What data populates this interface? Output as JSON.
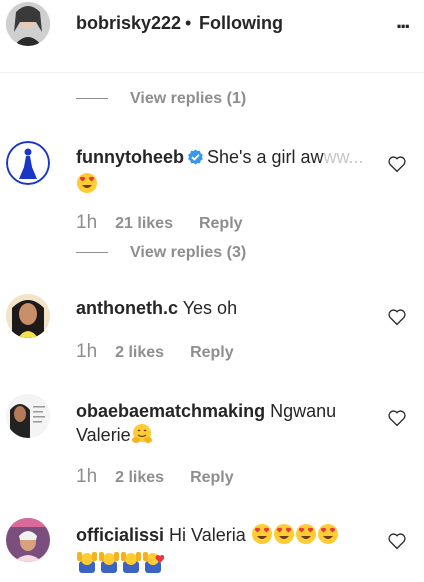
{
  "header": {
    "username": "bobrisky222",
    "separator": "•",
    "follow_status": "Following",
    "more_label": "..."
  },
  "prev_comment": {
    "view_replies": "View replies (1)"
  },
  "comments": [
    {
      "username": "funnytoheeb",
      "text_main": "She's a girl aw",
      "text_fade": "ww...",
      "time": "1h",
      "likes": "21 likes",
      "reply": "Reply",
      "view_replies": "View replies (3)"
    },
    {
      "username": "anthoneth.c",
      "text": "Yes oh",
      "time": "1h",
      "likes": "2 likes",
      "reply": "Reply"
    },
    {
      "username": "obaebaematchmaking",
      "text_line1": "Ngwanu",
      "text_line2": "Valerie",
      "time": "1h",
      "likes": "2 likes",
      "reply": "Reply"
    },
    {
      "username": "officialissi",
      "text": "Hi Valeria"
    }
  ],
  "colors": {
    "text": "#262626",
    "secondary": "#8e8e8e",
    "verified": "#3897f0",
    "emoji_face": "#ffcc33",
    "heart_eyes": "#e8383d"
  }
}
